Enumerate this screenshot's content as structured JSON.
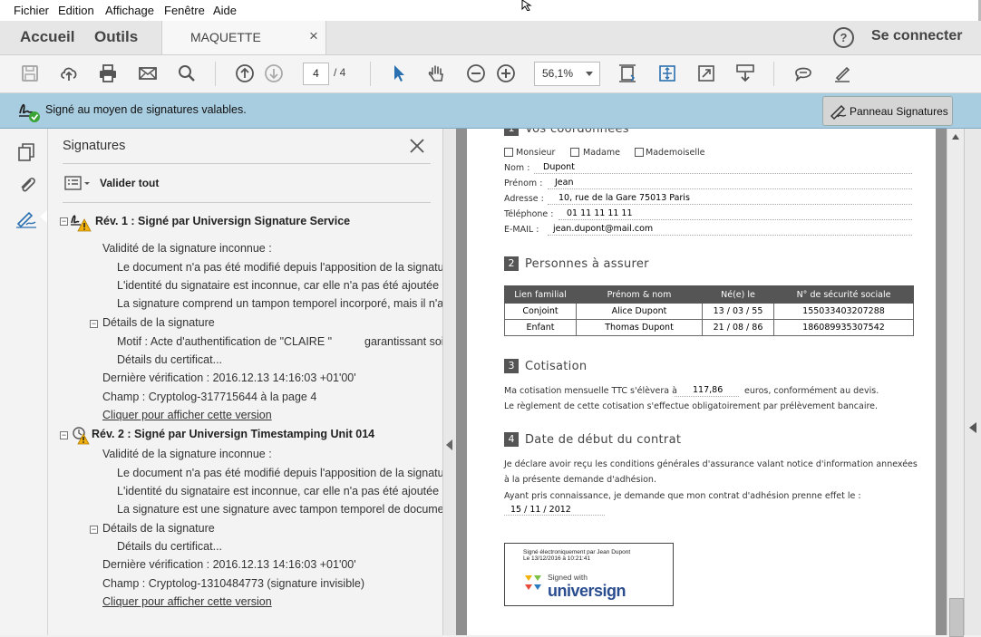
{
  "menu": [
    "Fichier",
    "Edition",
    "Affichage",
    "Fenêtre",
    "Aide"
  ],
  "tabs": {
    "home": "Accueil",
    "tools": "Outils",
    "document": "MAQUETTE",
    "close_glyph": "×"
  },
  "header_right": {
    "help_glyph": "?",
    "signin": "Se connecter"
  },
  "toolbar": {
    "page_current": "4",
    "page_total": "/ 4",
    "zoom": "56,1%"
  },
  "banner": {
    "message": "Signé au moyen de signatures valables.",
    "panel_button": "Panneau Signatures"
  },
  "panel": {
    "title": "Signatures",
    "validate_all": "Valider tout",
    "revisions": [
      {
        "title": "Rév. 1 : Signé par Universign Signature Service",
        "validity": "Validité de la signature inconnue :",
        "lines": [
          "Le document n'a pas été modifié depuis l'apposition de la signatur",
          "L'identité du signataire est inconnue, car elle n'a pas été ajoutée à l",
          "La signature comprend un tampon temporel incorporé, mais il n'a"
        ],
        "details_header": "Détails de la signature",
        "motif": "Motif : Acte d'authentification de \"CLAIRE \"",
        "motif_tail": "garantissant soi",
        "cert": "Détails du certificat...",
        "last_check": "Dernière vérification : 2016.12.13 14:16:03 +01'00'",
        "field": "Champ : Cryptolog-317715644 à la page 4",
        "link": "Cliquer pour afficher cette version"
      },
      {
        "title": "Rév. 2 : Signé par Universign Timestamping Unit 014",
        "validity": "Validité de la signature inconnue :",
        "lines": [
          "Le document n'a pas été modifié depuis l'apposition de la signatur",
          "L'identité du signataire est inconnue, car elle n'a pas été ajoutée à l",
          "La signature est une signature avec tampon temporel de documen"
        ],
        "details_header": "Détails de la signature",
        "cert": "Détails du certificat...",
        "last_check": "Dernière vérification : 2016.12.13 14:16:03 +01'00'",
        "field": "Champ : Cryptolog-1310484773 (signature invisible)",
        "link": "Cliquer pour afficher cette version"
      }
    ]
  },
  "document": {
    "section1": {
      "num": "1",
      "title": "Vos coordonnées"
    },
    "civility": [
      "Monsieur",
      "Madame",
      "Mademoiselle"
    ],
    "fields": [
      {
        "label": "Nom :",
        "value": "Dupont"
      },
      {
        "label": "Prénom :",
        "value": "Jean"
      },
      {
        "label": "Adresse :",
        "value": "10, rue de la Gare 75013 Paris"
      },
      {
        "label": "Téléphone :",
        "value": "01 11 11 11 11"
      },
      {
        "label": "E-MAIL :",
        "value": "jean.dupont@mail.com"
      }
    ],
    "section2": {
      "num": "2",
      "title": "Personnes à assurer"
    },
    "table": {
      "headers": [
        "Lien familial",
        "Prénom & nom",
        "Né(e) le",
        "N° de sécurité sociale"
      ],
      "rows": [
        [
          "Conjoint",
          "Alice Dupont",
          "13 / 03 / 55",
          "155033403207288"
        ],
        [
          "Enfant",
          "Thomas Dupont",
          "21 / 08 / 86",
          "186089935307542"
        ]
      ]
    },
    "section3": {
      "num": "3",
      "title": "Cotisation"
    },
    "cotisation": {
      "line1_a": "Ma cotisation mensuelle TTC s'élèvera à",
      "amount": "117,86",
      "line1_b": "euros, conformément au devis.",
      "line2": "Le règlement de cette cotisation s'effectue obligatoirement par prélèvement bancaire."
    },
    "section4": {
      "num": "4",
      "title": "Date de début du contrat"
    },
    "contract": {
      "line1": "Je déclare avoir reçu les conditions générales d'assurance valant notice d'information annexées",
      "line2": "à la présente demande d'adhésion.",
      "line3": "Ayant pris connaissance, je demande que mon contrat d'adhésion prenne effet le :",
      "date": "15 / 11 / 2012"
    },
    "stamp": {
      "line1": "Signé électroniquement par Jean Dupont",
      "line2": "Le 13/12/2016 à 10:21:41",
      "signed_with": "Signed with",
      "brand": "universign"
    }
  },
  "colors": {
    "banner": "#a9cde0",
    "accent_blue": "#2a6fb0",
    "warning": "#f2b10c",
    "valid_green": "#3aa335"
  }
}
